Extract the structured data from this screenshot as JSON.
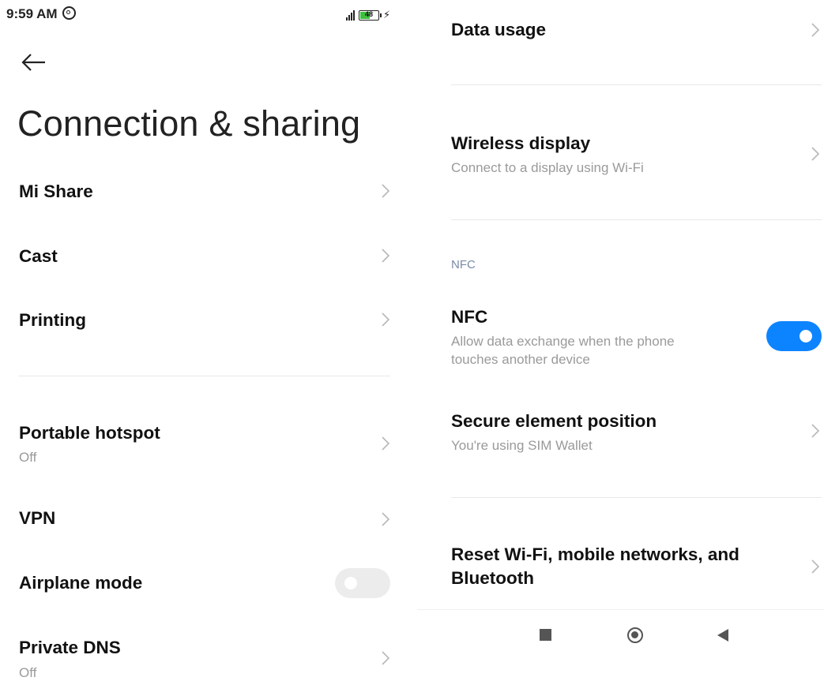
{
  "status_bar": {
    "time": "9:59 AM",
    "battery": "48"
  },
  "header": {
    "title": "Connection & sharing"
  },
  "left_list": [
    {
      "title": "Mi Share"
    },
    {
      "title": "Cast"
    },
    {
      "title": "Printing"
    },
    {
      "title": "Portable hotspot",
      "subtitle": "Off"
    },
    {
      "title": "VPN"
    },
    {
      "title": "Airplane mode",
      "toggle": "off"
    },
    {
      "title": "Private DNS",
      "subtitle": "Off"
    }
  ],
  "right_list": {
    "data_usage": {
      "title": "Data usage"
    },
    "wireless_display": {
      "title": "Wireless display",
      "subtitle": "Connect to a display using Wi-Fi"
    },
    "nfc_section_label": "NFC",
    "nfc": {
      "title": "NFC",
      "subtitle_line1": "Allow data exchange when the phone",
      "subtitle_line2": "touches another device",
      "toggle": "on"
    },
    "secure_element": {
      "title": "Secure element position",
      "subtitle": "You're using SIM Wallet"
    },
    "reset": {
      "title_line1": "Reset Wi-Fi, mobile networks, and",
      "title_line2": "Bluetooth"
    }
  },
  "icons": {
    "back": "back-arrow-icon",
    "chevron": "chevron-right-icon",
    "nav_recents": "square-icon",
    "nav_home": "circle-icon",
    "nav_back": "triangle-back-icon"
  },
  "colors": {
    "accent": "#0d84ff",
    "subtitle": "#9a9a9a",
    "section_label": "#7a8aa6",
    "divider": "#e8e8e8"
  }
}
